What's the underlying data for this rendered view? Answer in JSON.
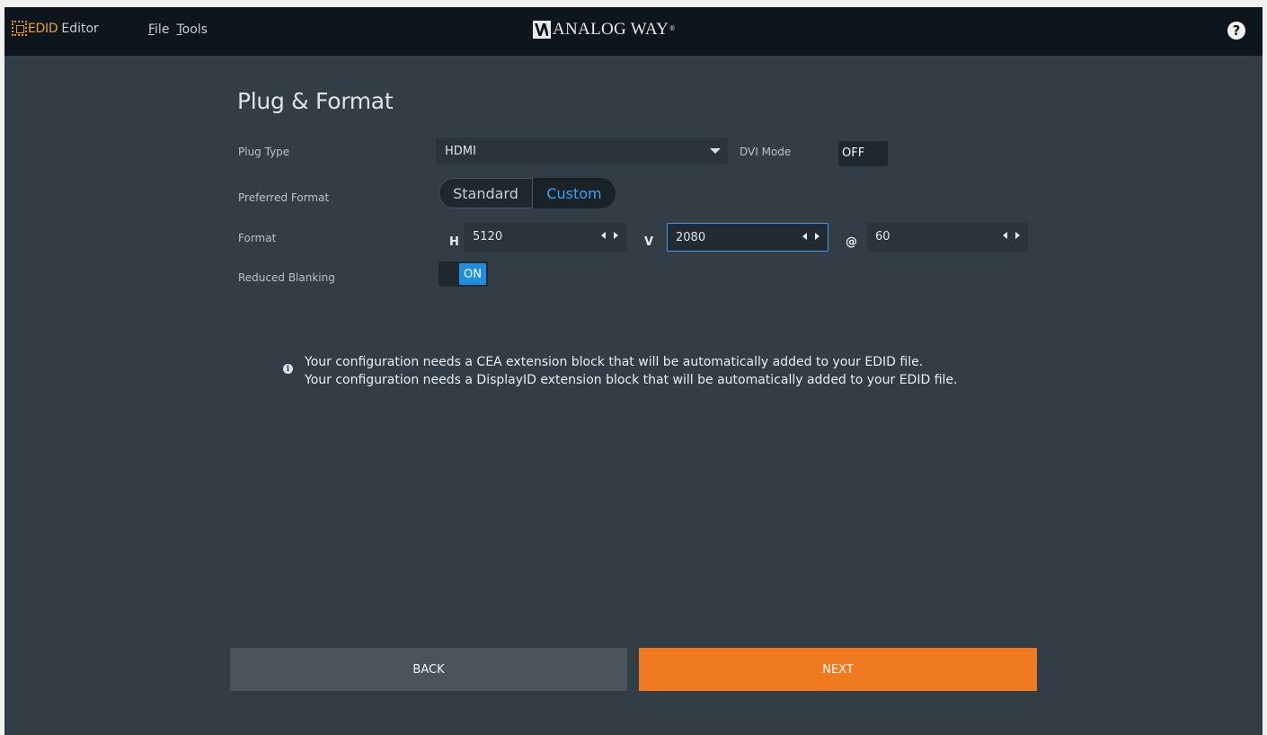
{
  "titlebar": {
    "app_edid": "EDID",
    "app_editor": "Editor",
    "menu": [
      {
        "accel": "F",
        "rest": "ile"
      },
      {
        "accel": "T",
        "rest": "ools"
      }
    ],
    "brand": "ANALOG WAY",
    "brand_mark": "®",
    "help": "?"
  },
  "page": {
    "title": "Plug & Format",
    "plug_type_label": "Plug Type",
    "plug_type_value": "HDMI",
    "dvi_mode_label": "DVI Mode",
    "dvi_mode_value": "OFF",
    "preferred_format_label": "Preferred Format",
    "preferred_format_options": [
      "Standard",
      "Custom"
    ],
    "preferred_format_selected": "Custom",
    "format_label": "Format",
    "h_label": "H",
    "h_value": "5120",
    "v_label": "V",
    "v_value": "2080",
    "at_label": "@",
    "rate_value": "60",
    "reduced_blanking_label": "Reduced Blanking",
    "reduced_blanking_value": "ON"
  },
  "info": {
    "lines": [
      "Your configuration needs a CEA extension block that will be automatically added to your EDID file.",
      "Your configuration needs a DisplayID extension block that will be automatically added to your EDID file."
    ],
    "icon": "info-icon"
  },
  "footer": {
    "back_label": "BACK",
    "next_label": "NEXT"
  },
  "colors": {
    "background": "#333d46",
    "titlebar": "#0d161c",
    "accent_orange": "#f07a20",
    "accent_blue": "#1f8de0",
    "edid_orange": "#f0a22a"
  }
}
